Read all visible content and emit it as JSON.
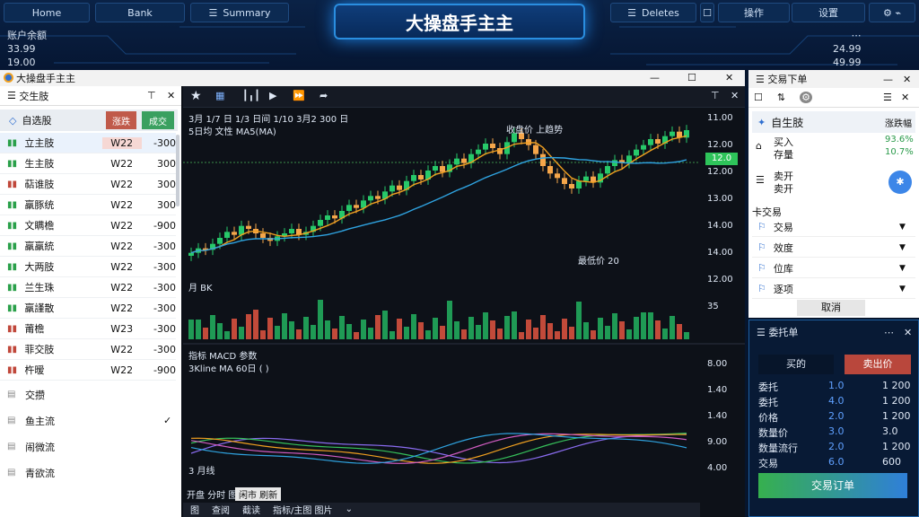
{
  "topbar": {
    "home": "Home",
    "bank": "Bank",
    "summary": "Summary",
    "deletes": "Deletes",
    "btn1": "操作",
    "btn2": "设置"
  },
  "banner": {
    "title": "大操盘手主主"
  },
  "stats": {
    "left_label": "账户余额",
    "left_v1": "33.99",
    "left_v2": "19.00",
    "right_v1": "24.99",
    "right_v2": "49.99"
  },
  "window": {
    "title": "大操盘手主主",
    "controls": [
      "—",
      "☐",
      "✕"
    ]
  },
  "watch": {
    "header": "交生肢",
    "group": "自选股",
    "sort1": "涨跌",
    "sort2": "成交",
    "rows": [
      {
        "name": "立主肢",
        "code": "W22",
        "val": "-300",
        "up": true
      },
      {
        "name": "生主肢",
        "code": "W22",
        "val": "300",
        "up": true
      },
      {
        "name": "萜谁肢",
        "code": "W22",
        "val": "300",
        "up": false
      },
      {
        "name": "羸豚统",
        "code": "W22",
        "val": "300",
        "up": true
      },
      {
        "name": "文瞒檐",
        "code": "W22",
        "val": "-900",
        "up": true
      },
      {
        "name": "羸羸統",
        "code": "W22",
        "val": "-300",
        "up": true
      },
      {
        "name": "大两肢",
        "code": "W22",
        "val": "-300",
        "up": true
      },
      {
        "name": "兰生珠",
        "code": "W22",
        "val": "-300",
        "up": true
      },
      {
        "name": "羸謹散",
        "code": "W22",
        "val": "-300",
        "up": true
      },
      {
        "name": "莆檐",
        "code": "W23",
        "val": "-300",
        "up": false
      },
      {
        "name": "菲交肢",
        "code": "W22",
        "val": "-300",
        "up": false
      },
      {
        "name": "杵暧",
        "code": "W22",
        "val": "-900",
        "up": false
      }
    ],
    "extras": [
      "交攒",
      "鱼主流",
      "闹微流",
      "青欲流"
    ]
  },
  "chart": {
    "info": "3月 1/7 日 1/3 日间 1/10 3月2 300 日",
    "ma_legend": "5日均 文性 MA5(MA)",
    "annot_top": "收盘价 上趋势",
    "annot_low": "最低价 20",
    "price_tag": "12.0",
    "yaxis": [
      "11.00",
      "12.00",
      "12.00",
      "13.00",
      "14.00",
      "14.00",
      "12.00",
      "35"
    ],
    "ind_legend1": "指标 MACD 参数",
    "ind_legend2": "3Kline MA 60日 ( )",
    "ind_yaxis": [
      "8.00",
      "1.40",
      "1.40",
      "9.00",
      "4.00"
    ],
    "ind_foot": "3 月线",
    "tabs": [
      "开盘 分时 图",
      "闲市 刷新"
    ],
    "bottom": [
      "图",
      "查阅",
      "截读",
      "指标/主图 图片"
    ]
  },
  "right": {
    "title": "交易下单",
    "stock_name": "自生肢",
    "stock_tag": "涨跌幅",
    "buy_label": "买入",
    "buy_sub": "存量",
    "buy_v1": "93.6%",
    "buy_v2": "10.7%",
    "sell_label": "卖开",
    "sell_sub": "卖开",
    "section": "卡交易",
    "items": [
      "交易",
      "效度",
      "位库",
      "逐项"
    ],
    "footer": "取消"
  },
  "trade": {
    "title": "委托单",
    "tab_buy": "买的",
    "tab_sell": "卖出价",
    "rows": [
      {
        "label": "委托",
        "a": "1.0",
        "b": "1 200"
      },
      {
        "label": "委托",
        "a": "4.0",
        "b": "1 200"
      },
      {
        "label": "价格",
        "a": "2.0",
        "b": "1 200"
      },
      {
        "label": "数量价",
        "a": "3.0",
        "b": "3.0"
      },
      {
        "label": "数量流行",
        "a": "2.0",
        "b": "1 200"
      },
      {
        "label": "交易",
        "a": "6.0",
        "b": "600"
      }
    ],
    "submit": "交易订单"
  },
  "colors": {
    "up": "#27c96a",
    "down": "#f5a64a",
    "accent": "#2f7fd9",
    "bg": "#0b0f17"
  },
  "chart_data": {
    "type": "candlestick",
    "closes": [
      11.0,
      11.3,
      11.2,
      11.6,
      12.0,
      12.4,
      12.2,
      12.8,
      12.6,
      12.3,
      12.0,
      11.8,
      12.1,
      12.3,
      12.6,
      12.2,
      12.4,
      12.8,
      13.2,
      13.5,
      13.3,
      13.8,
      14.2,
      14.0,
      14.5,
      14.8,
      14.6,
      15.1,
      15.5,
      15.2,
      15.8,
      16.2,
      15.9,
      16.5,
      16.8,
      16.4,
      16.9,
      17.3,
      17.0,
      17.6,
      17.9,
      18.3,
      18.0,
      17.6,
      18.4,
      19.0,
      18.6,
      18.2,
      17.6,
      16.8,
      16.3,
      16.0,
      15.6,
      15.3,
      15.8,
      16.1,
      15.7,
      16.3,
      16.8,
      17.2,
      17.0,
      17.5,
      17.9,
      18.2,
      18.6,
      18.3,
      18.8,
      19.1,
      18.7,
      19.2
    ]
  }
}
